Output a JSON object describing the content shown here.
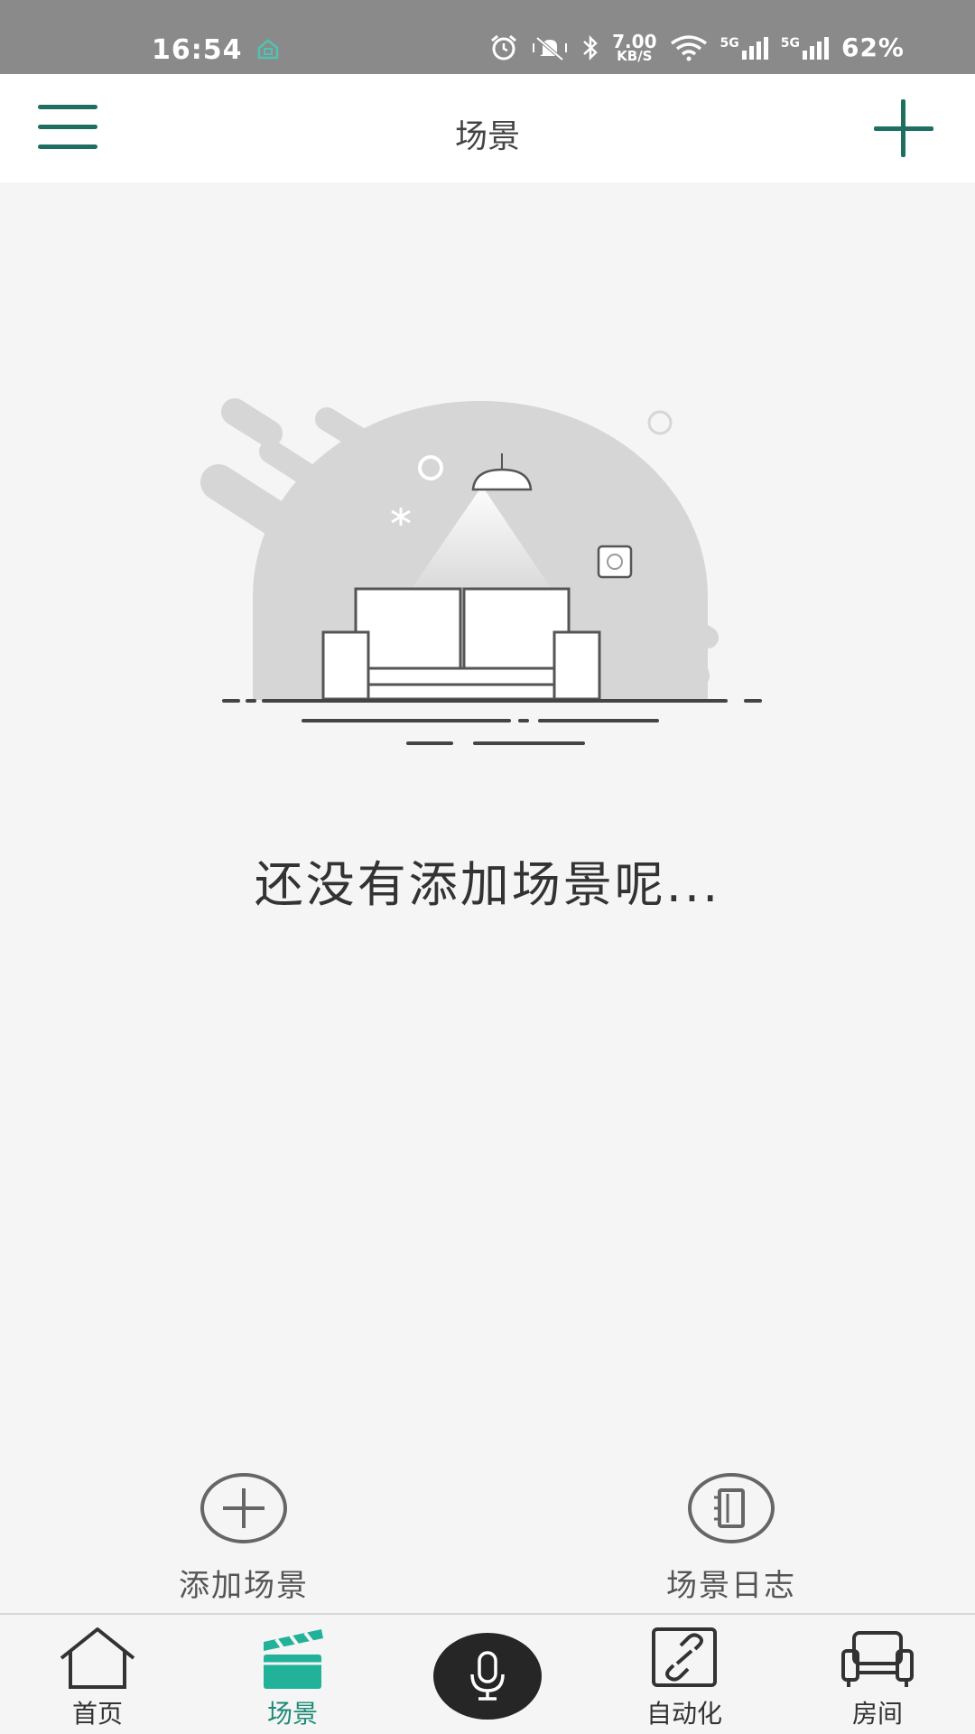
{
  "status_bar": {
    "time": "16:54",
    "net_speed_value": "7.00",
    "net_speed_unit": "KB/S",
    "signal_1_label": "5G",
    "signal_2_label": "5G",
    "battery": "62%",
    "icons": [
      "home-icon",
      "alarm-icon",
      "mute-vibrate-icon",
      "bluetooth-icon",
      "wifi-icon",
      "signal-icon",
      "signal-icon"
    ]
  },
  "header": {
    "title": "场景",
    "menu_icon": "hamburger-menu-icon",
    "add_icon": "plus-icon"
  },
  "empty_state": {
    "message": "还没有添加场景呢..."
  },
  "quick_actions": [
    {
      "label": "添加场景",
      "icon": "add-circle-icon"
    },
    {
      "label": "场景日志",
      "icon": "log-book-icon"
    }
  ],
  "bottom_nav": {
    "items": [
      {
        "label": "首页",
        "icon": "house-icon",
        "active": false
      },
      {
        "label": "场景",
        "icon": "clapperboard-icon",
        "active": true
      },
      {
        "label": "自动化",
        "icon": "link-icon",
        "active": false
      },
      {
        "label": "房间",
        "icon": "sofa-icon",
        "active": false
      }
    ],
    "voice_icon": "microphone-icon"
  },
  "colors": {
    "accent": "#1e6e62",
    "active_tab": "#1e8a78",
    "status_bar": "#8a8a8a",
    "background": "#f5f5f5"
  }
}
